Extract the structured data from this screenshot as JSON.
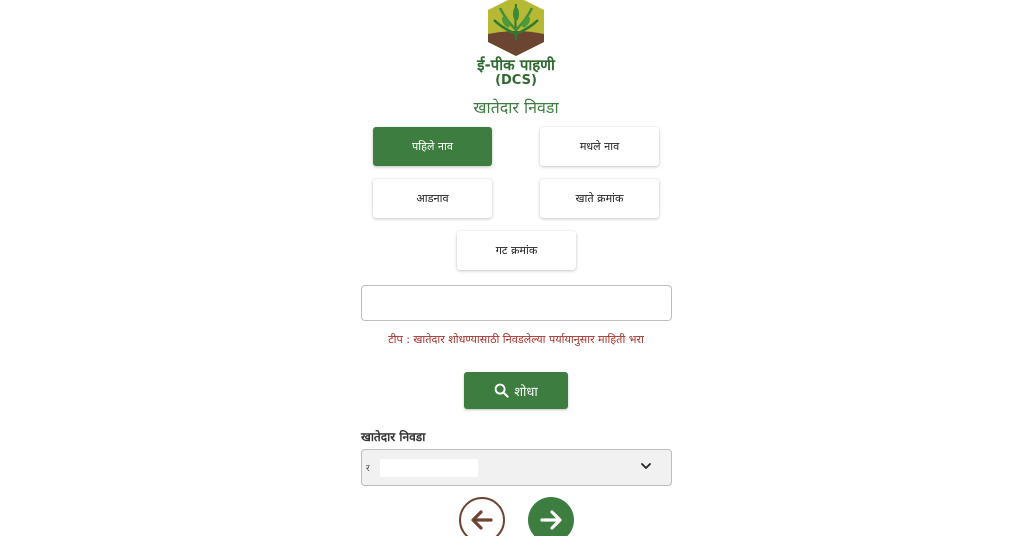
{
  "app": {
    "title": "ई-पीक पाहणी",
    "subtitle": "(DCS)"
  },
  "page": {
    "title": "खातेदार निवडा"
  },
  "search_options": [
    {
      "label": "पहिले नाव",
      "active": true
    },
    {
      "label": "मधले नाव",
      "active": false
    },
    {
      "label": "आडनाव",
      "active": false
    },
    {
      "label": "खाते क्रमांक",
      "active": false
    },
    {
      "label": "गट क्रमांक",
      "active": false
    }
  ],
  "search": {
    "value": "",
    "tip": "टीप : खातेदार शोधण्यासाठी निवडलेल्या पर्यायानुसार माहिती भरा",
    "button_label": "शोधा"
  },
  "owner_select": {
    "label": "खातेदार निवडा",
    "selected_value": "र"
  },
  "colors": {
    "primary_green": "#3d7e40",
    "tip_red": "#a3302b",
    "back_brown": "#6e4433"
  },
  "icons": {
    "search_button": "search-icon",
    "select": "chevron-down-icon",
    "back": "arrow-left-icon",
    "next": "arrow-right-icon"
  }
}
